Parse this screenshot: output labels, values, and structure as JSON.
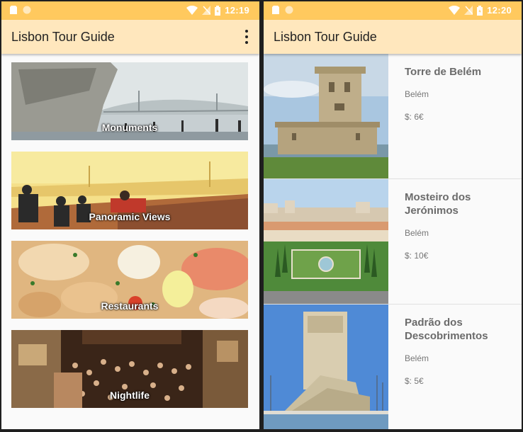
{
  "left": {
    "status": {
      "time": "12:19"
    },
    "app_title": "Lisbon Tour Guide",
    "categories": [
      {
        "label": "Monuments"
      },
      {
        "label": "Panoramic Views"
      },
      {
        "label": "Restaurants"
      },
      {
        "label": "Nightlife"
      }
    ]
  },
  "right": {
    "status": {
      "time": "12:20"
    },
    "app_title": "Lisbon Tour Guide",
    "places": [
      {
        "name": "Torre de Belém",
        "location": "Belém",
        "price": "$: 6€"
      },
      {
        "name": "Mosteiro dos Jerónimos",
        "location": "Belém",
        "price": "$: 10€"
      },
      {
        "name": "Padrão dos Descobrimentos",
        "location": "Belém",
        "price": "$: 5€"
      }
    ]
  },
  "colors": {
    "status_bar": "#ffc95e",
    "app_bar": "#ffe7bd",
    "background": "#fafafa"
  },
  "icons": [
    "sd-card-icon",
    "circle-notification-icon",
    "wifi-icon",
    "no-signal-icon",
    "battery-icon",
    "overflow-menu-icon"
  ]
}
